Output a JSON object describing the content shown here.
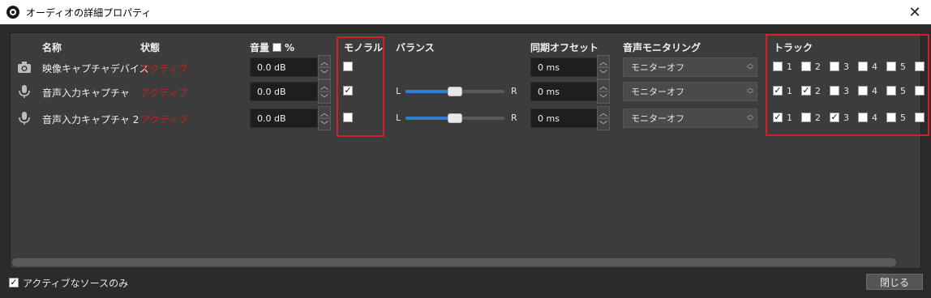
{
  "window": {
    "title": "オーディオの詳細プロパティ",
    "close_glyph": "✕"
  },
  "headers": {
    "name": "名称",
    "status": "状態",
    "volume": "音量",
    "percent": "%",
    "mono": "モノラル",
    "balance": "バランス",
    "sync_offset": "同期オフセット",
    "monitoring": "音声モニタリング",
    "tracks": "トラック"
  },
  "rows": [
    {
      "icon": "camera-icon",
      "name": "映像キャプチャデバイス",
      "status": "アクティブ",
      "volume": "0.0 dB",
      "mono": false,
      "balance_visible": false,
      "offset": "0 ms",
      "monitoring": "モニターオフ",
      "tracks": [
        false,
        false,
        false,
        false,
        false,
        false
      ]
    },
    {
      "icon": "microphone-icon",
      "name": "音声入力キャプチャ",
      "status": "アクティブ",
      "volume": "0.0 dB",
      "mono": true,
      "balance_visible": true,
      "balance_left": "L",
      "balance_right": "R",
      "balance": 0.5,
      "offset": "0 ms",
      "monitoring": "モニターオフ",
      "tracks": [
        true,
        true,
        false,
        false,
        false,
        false
      ]
    },
    {
      "icon": "microphone-icon",
      "name": "音声入力キャプチャ 2",
      "status": "アクティブ",
      "volume": "0.0 dB",
      "mono": false,
      "balance_visible": true,
      "balance_left": "L",
      "balance_right": "R",
      "balance": 0.5,
      "offset": "0 ms",
      "monitoring": "モニターオフ",
      "tracks": [
        true,
        false,
        true,
        false,
        false,
        false
      ]
    }
  ],
  "track_labels": [
    "1",
    "2",
    "3",
    "4",
    "5"
  ],
  "footer": {
    "active_only_label": "アクティブなソースのみ",
    "active_only_checked": true,
    "close_button": "閉じる"
  },
  "colors": {
    "status_active": "#d21c1c",
    "highlight_box": "#d2202a",
    "slider_fill": "#2f7fd6"
  }
}
